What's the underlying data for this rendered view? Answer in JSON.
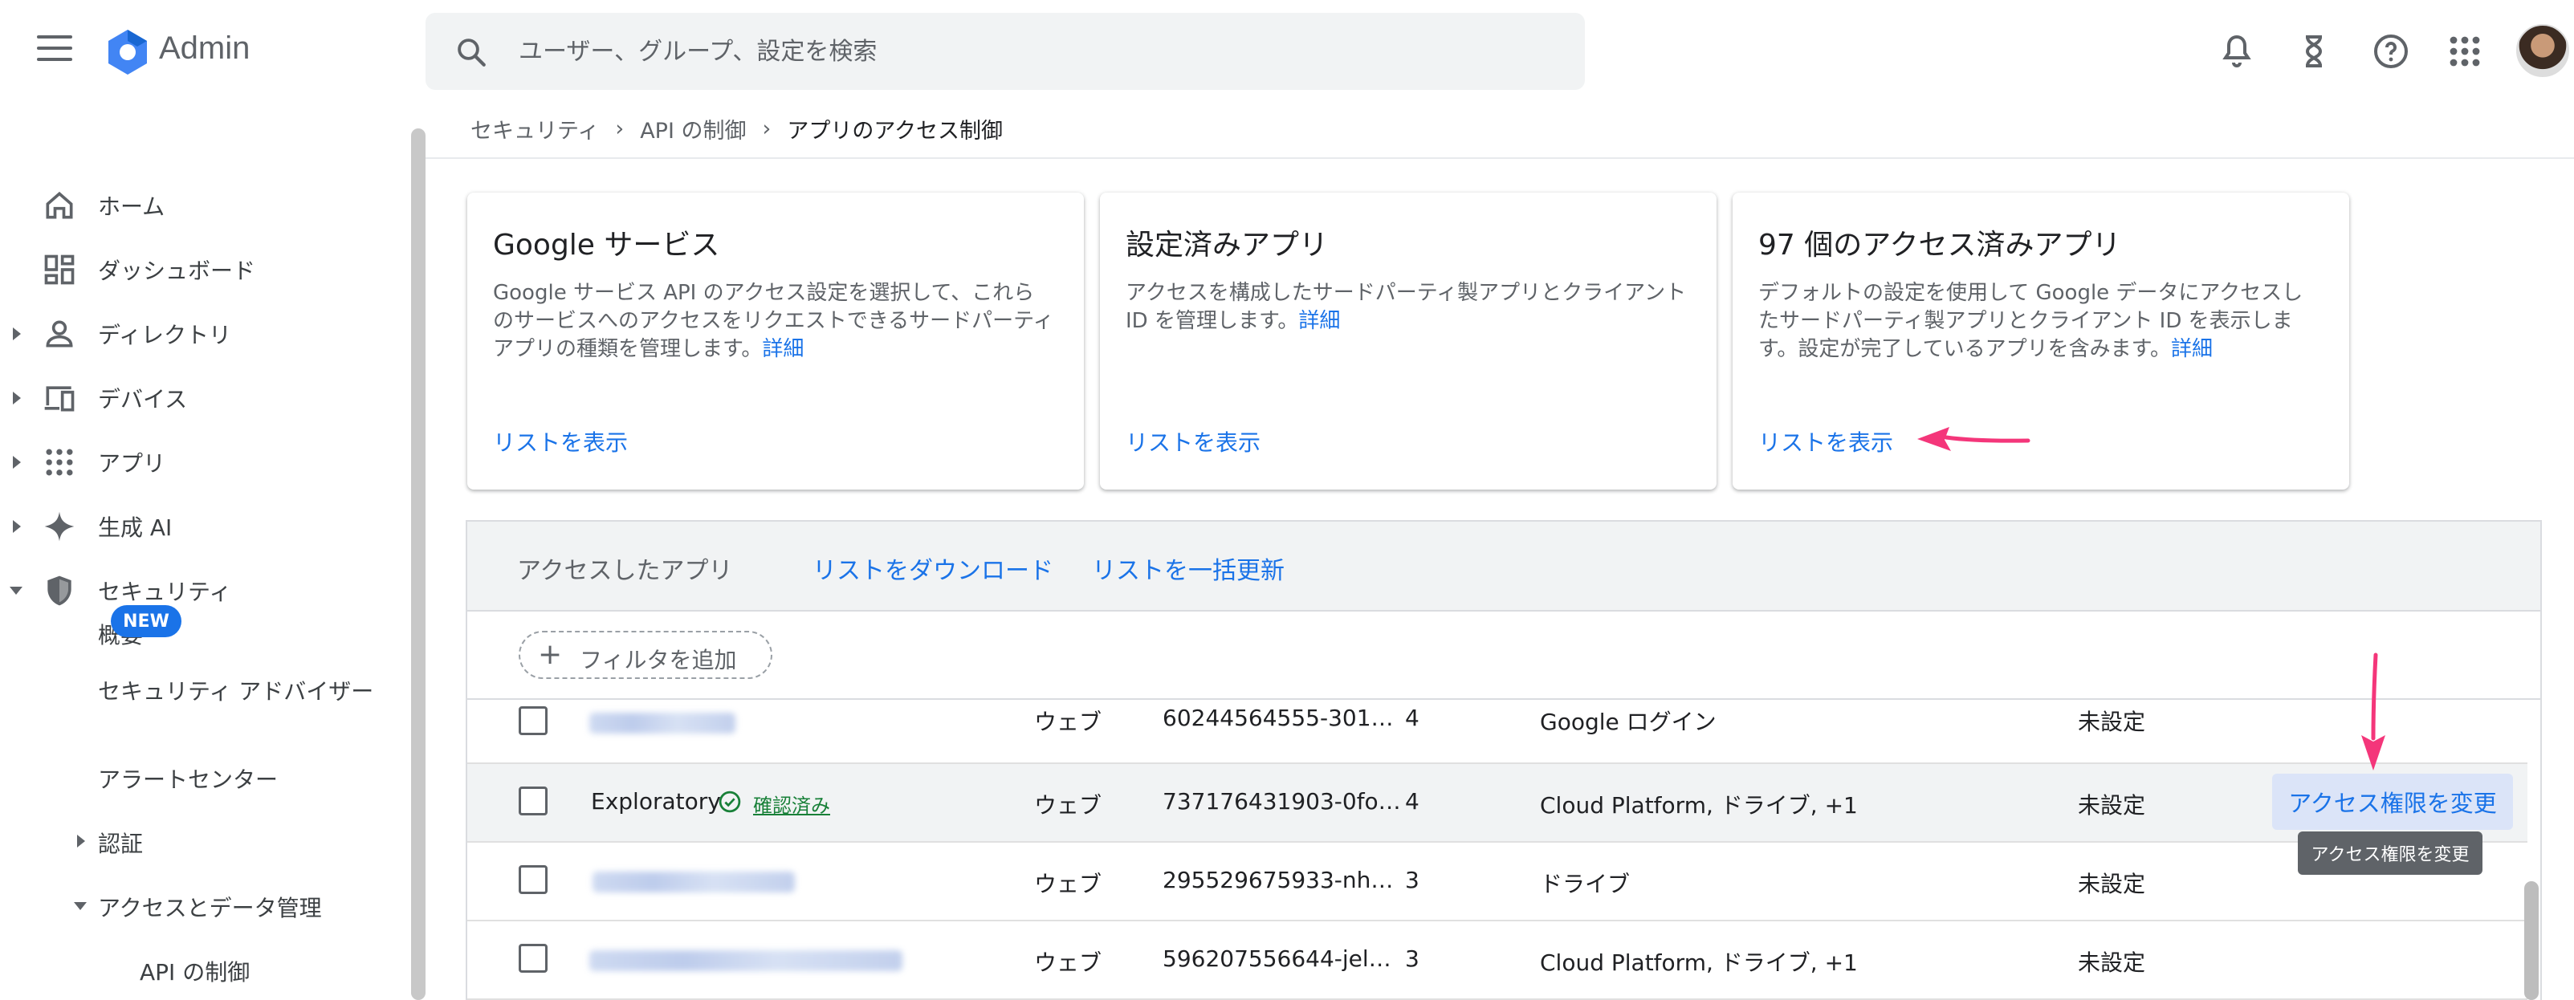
{
  "app": {
    "title": "Admin"
  },
  "search": {
    "placeholder": "ユーザー、グループ、設定を検索"
  },
  "top_icons": [
    "notifications-icon",
    "hourglass-icon",
    "help-icon",
    "apps-grid-icon"
  ],
  "sidebar": {
    "items": [
      {
        "label": "ホーム",
        "icon": "home-icon",
        "expandable": false
      },
      {
        "label": "ダッシュボード",
        "icon": "dashboard-icon",
        "expandable": false
      },
      {
        "label": "ディレクトリ",
        "icon": "person-icon",
        "expandable": true
      },
      {
        "label": "デバイス",
        "icon": "devices-icon",
        "expandable": true
      },
      {
        "label": "アプリ",
        "icon": "apps-icon",
        "expandable": true
      },
      {
        "label": "生成 AI",
        "icon": "sparkle-icon",
        "expandable": true
      },
      {
        "label": "セキュリティ",
        "icon": "shield-icon",
        "expandable": true,
        "expanded": true
      }
    ],
    "security_sub": {
      "overview": "概要",
      "advisor": "セキュリティ アドバイザー",
      "advisor_badge": "NEW",
      "alert_center": "アラートセンター",
      "auth": "認証",
      "access_data": "アクセスとデータ管理",
      "api_controls": "API の制御"
    }
  },
  "breadcrumb": {
    "items": [
      "セキュリティ",
      "API の制御"
    ],
    "current": "アプリのアクセス制御"
  },
  "cards": [
    {
      "title": "Google サービス",
      "body": "Google サービス API のアクセス設定を選択して、これらのサービスへのアクセスをリクエストできるサードパーティ アプリの種類を管理します。",
      "detail_link": "詳細",
      "action": "リストを表示"
    },
    {
      "title": "設定済みアプリ",
      "body": "アクセスを構成したサードパーティ製アプリとクライアント ID を管理します。",
      "detail_link": "詳細",
      "action": "リストを表示"
    },
    {
      "title": "97 個のアクセス済みアプリ",
      "body": "デフォルトの設定を使用して Google データにアクセスしたサードパーティ製アプリとクライアント ID を表示します。設定が完了しているアプリを含みます。",
      "detail_link": "詳細",
      "action": "リストを表示"
    }
  ],
  "accessed_apps": {
    "title": "アクセスしたアプリ",
    "download": "リストをダウンロード",
    "bulk_update": "リストを一括更新",
    "add_filter": "フィルタを追加",
    "rows": [
      {
        "name": "",
        "verified": "",
        "type": "ウェブ",
        "client_id": "60244564555-301…",
        "users": "4",
        "services": "Google ログイン",
        "status": "未設定"
      },
      {
        "name": "Exploratory",
        "verified": "確認済み",
        "type": "ウェブ",
        "client_id": "737176431903-0fo…",
        "users": "4",
        "services": "Cloud Platform, ドライブ, +1",
        "status": "未設定",
        "action": "アクセス権限を変更"
      },
      {
        "name": "",
        "verified": "",
        "type": "ウェブ",
        "client_id": "295529675933-nh…",
        "users": "3",
        "services": "ドライブ",
        "status": "未設定"
      },
      {
        "name": "",
        "verified": "",
        "type": "ウェブ",
        "client_id": "596207556644-jel…",
        "users": "3",
        "services": "Cloud Platform, ドライブ, +1",
        "status": "未設定"
      }
    ],
    "tooltip": "アクセス権限を変更"
  },
  "colors": {
    "accent": "#1a73e8",
    "verified": "#188038",
    "annotation_arrow": "#f4367a"
  }
}
